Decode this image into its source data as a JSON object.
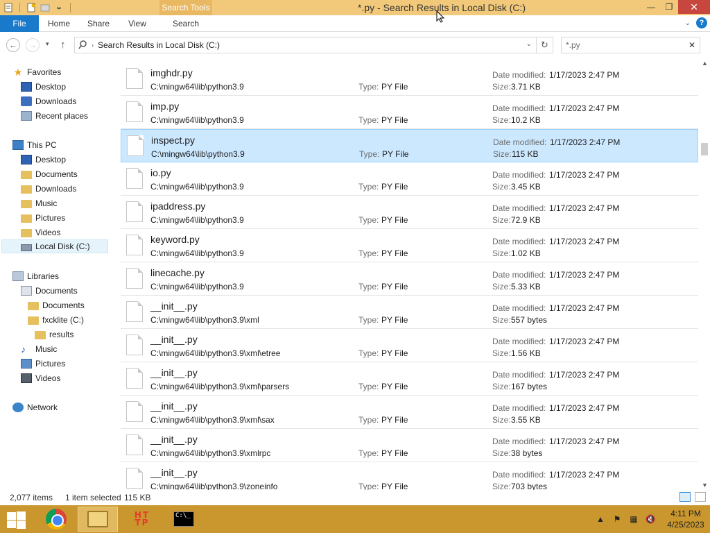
{
  "window": {
    "title": "*.py - Search Results in Local Disk (C:)",
    "contextual_tab": "Search Tools",
    "minimize": "—",
    "restore": "❐",
    "close": "✕"
  },
  "ribbon": {
    "tabs": [
      "File",
      "Home",
      "Share",
      "View",
      "Search"
    ],
    "expand_icon": "⌄",
    "help": "?"
  },
  "address": {
    "back_icon": "←",
    "forward_icon": "→",
    "dropdown_icon": "▾",
    "up_icon": "↑",
    "crumb_sep": "›",
    "path": "Search Results in Local Disk (C:)",
    "path_dropdown": "⌄",
    "refresh_icon": "↻"
  },
  "search": {
    "value": "*.py",
    "clear_icon": "✕"
  },
  "navigation": {
    "favorites": {
      "label": "Favorites",
      "items": [
        "Desktop",
        "Downloads",
        "Recent places"
      ]
    },
    "this_pc": {
      "label": "This PC",
      "items": [
        "Desktop",
        "Documents",
        "Downloads",
        "Music",
        "Pictures",
        "Videos",
        "Local Disk (C:)"
      ]
    },
    "libraries": {
      "label": "Libraries",
      "documents": "Documents",
      "documents_children": [
        "Documents",
        "fxcklite (C:)"
      ],
      "results": "results",
      "items": [
        "Music",
        "Pictures",
        "Videos"
      ]
    },
    "network": {
      "label": "Network"
    }
  },
  "files": {
    "type_label": "Type:",
    "date_label": "Date modified:",
    "size_label": "Size:",
    "rows": [
      {
        "name": "imghdr.py",
        "path": "C:\\mingw64\\lib\\python3.9",
        "type": "PY File",
        "date": "1/17/2023 2:47 PM",
        "size": "3.71 KB",
        "selected": false
      },
      {
        "name": "imp.py",
        "path": "C:\\mingw64\\lib\\python3.9",
        "type": "PY File",
        "date": "1/17/2023 2:47 PM",
        "size": "10.2 KB",
        "selected": false
      },
      {
        "name": "inspect.py",
        "path": "C:\\mingw64\\lib\\python3.9",
        "type": "PY File",
        "date": "1/17/2023 2:47 PM",
        "size": "115 KB",
        "selected": true
      },
      {
        "name": "io.py",
        "path": "C:\\mingw64\\lib\\python3.9",
        "type": "PY File",
        "date": "1/17/2023 2:47 PM",
        "size": "3.45 KB",
        "selected": false
      },
      {
        "name": "ipaddress.py",
        "path": "C:\\mingw64\\lib\\python3.9",
        "type": "PY File",
        "date": "1/17/2023 2:47 PM",
        "size": "72.9 KB",
        "selected": false
      },
      {
        "name": "keyword.py",
        "path": "C:\\mingw64\\lib\\python3.9",
        "type": "PY File",
        "date": "1/17/2023 2:47 PM",
        "size": "1.02 KB",
        "selected": false
      },
      {
        "name": "linecache.py",
        "path": "C:\\mingw64\\lib\\python3.9",
        "type": "PY File",
        "date": "1/17/2023 2:47 PM",
        "size": "5.33 KB",
        "selected": false
      },
      {
        "name": "__init__.py",
        "path": "C:\\mingw64\\lib\\python3.9\\xml",
        "type": "PY File",
        "date": "1/17/2023 2:47 PM",
        "size": "557 bytes",
        "selected": false
      },
      {
        "name": "__init__.py",
        "path": "C:\\mingw64\\lib\\python3.9\\xml\\etree",
        "type": "PY File",
        "date": "1/17/2023 2:47 PM",
        "size": "1.56 KB",
        "selected": false
      },
      {
        "name": "__init__.py",
        "path": "C:\\mingw64\\lib\\python3.9\\xml\\parsers",
        "type": "PY File",
        "date": "1/17/2023 2:47 PM",
        "size": "167 bytes",
        "selected": false
      },
      {
        "name": "__init__.py",
        "path": "C:\\mingw64\\lib\\python3.9\\xml\\sax",
        "type": "PY File",
        "date": "1/17/2023 2:47 PM",
        "size": "3.55 KB",
        "selected": false
      },
      {
        "name": "__init__.py",
        "path": "C:\\mingw64\\lib\\python3.9\\xmlrpc",
        "type": "PY File",
        "date": "1/17/2023 2:47 PM",
        "size": "38 bytes",
        "selected": false
      },
      {
        "name": "__init__.py",
        "path": "C:\\mingw64\\lib\\python3.9\\zoneinfo",
        "type": "PY File",
        "date": "1/17/2023 2:47 PM",
        "size": "703 bytes",
        "selected": false
      }
    ]
  },
  "status": {
    "count": "2,077 items",
    "selected": "1 item selected",
    "size": "115 KB"
  },
  "taskbar": {
    "http_label": "HTTP",
    "cmd_label": "C:\\_",
    "time": "4:11 PM",
    "date": "4/25/2023"
  },
  "colors": {
    "title_bar": "#f2c97a",
    "file_tab": "#1979ca",
    "selection": "#cce8ff",
    "taskbar": "#c9972e"
  }
}
